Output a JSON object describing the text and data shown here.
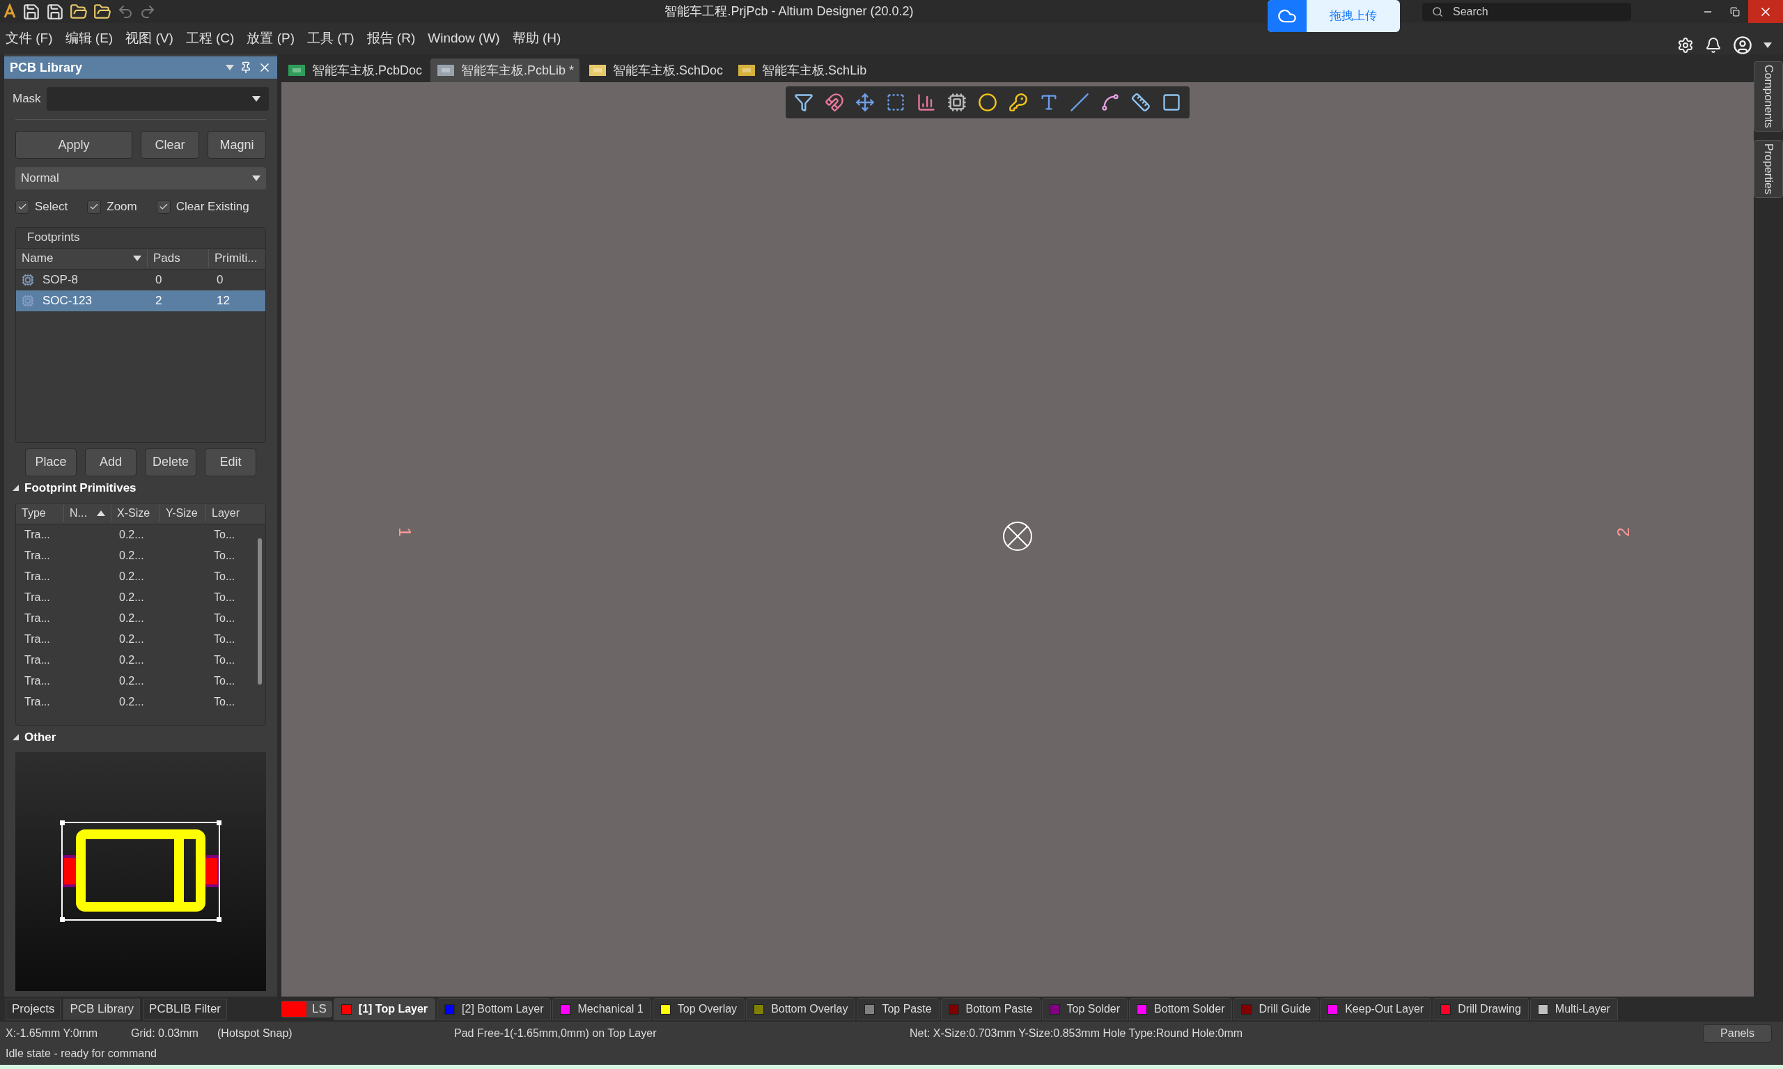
{
  "title_bar": {
    "title": "智能车工程.PrjPcb - Altium Designer (20.0.2)",
    "upload_button": "拖拽上传",
    "search": {
      "placeholder": "Search"
    }
  },
  "menu": [
    "文件 (F)",
    "编辑 (E)",
    "视图 (V)",
    "工程 (C)",
    "放置 (P)",
    "工具 (T)",
    "报告 (R)",
    "Window (W)",
    "帮助 (H)"
  ],
  "panel": {
    "title": "PCB Library",
    "mask": {
      "label": "Mask"
    },
    "filter_buttons": [
      "Apply",
      "Clear",
      "Magni"
    ],
    "mode": "Normal",
    "options": [
      {
        "label": "Select",
        "checked": true
      },
      {
        "label": "Zoom",
        "checked": true
      },
      {
        "label": "Clear Existing",
        "checked": true
      }
    ],
    "footprints": {
      "title": "Footprints",
      "columns": [
        "Name",
        "Pads",
        "Primiti..."
      ],
      "rows": [
        {
          "name": "SOP-8",
          "pads": "0",
          "primitives": "0",
          "selected": false
        },
        {
          "name": "SOC-123",
          "pads": "2",
          "primitives": "12",
          "selected": true
        }
      ]
    },
    "actions": [
      "Place",
      "Add",
      "Delete",
      "Edit"
    ],
    "primitives": {
      "title": "Footprint Primitives",
      "expanded": true,
      "columns": [
        "Type",
        "N...",
        "X-Size",
        "Y-Size",
        "Layer"
      ],
      "rows": [
        {
          "type": "Tra...",
          "x_size": "0.2...",
          "layer": "To..."
        },
        {
          "type": "Tra...",
          "x_size": "0.2...",
          "layer": "To..."
        },
        {
          "type": "Tra...",
          "x_size": "0.2...",
          "layer": "To..."
        },
        {
          "type": "Tra...",
          "x_size": "0.2...",
          "layer": "To..."
        },
        {
          "type": "Tra...",
          "x_size": "0.2...",
          "layer": "To..."
        },
        {
          "type": "Tra...",
          "x_size": "0.2...",
          "layer": "To..."
        },
        {
          "type": "Tra...",
          "x_size": "0.2...",
          "layer": "To..."
        },
        {
          "type": "Tra...",
          "x_size": "0.2...",
          "layer": "To..."
        },
        {
          "type": "Tra...",
          "x_size": "0.2...",
          "layer": "To..."
        }
      ]
    },
    "other": {
      "title": "Other",
      "expanded": true
    }
  },
  "doc_tabs": [
    {
      "label": "智能车主板.PcbDoc",
      "kind": "pcb",
      "selected": false
    },
    {
      "label": "智能车主板.PcbLib *",
      "kind": "pcblib",
      "selected": true
    },
    {
      "label": "智能车主板.SchDoc",
      "kind": "sch",
      "selected": false
    },
    {
      "label": "智能车主板.SchLib",
      "kind": "schlib",
      "selected": false
    }
  ],
  "canvas": {
    "pad_labels": [
      "1",
      "2"
    ]
  },
  "side_panels": [
    "Components",
    "Properties"
  ],
  "bottom_tabs": [
    {
      "label": "Projects",
      "selected": false
    },
    {
      "label": "PCB Library",
      "selected": true
    },
    {
      "label": "PCBLIB Filter",
      "selected": false
    }
  ],
  "layer_set": {
    "label": "LS",
    "color": "#ff0000"
  },
  "layers": [
    {
      "label": "[1] Top Layer",
      "color": "#ff0000",
      "selected": true
    },
    {
      "label": "[2] Bottom Layer",
      "color": "#0000ff",
      "selected": false
    },
    {
      "label": "Mechanical 1",
      "color": "#ff00ff",
      "selected": false
    },
    {
      "label": "Top Overlay",
      "color": "#ffff00",
      "selected": false
    },
    {
      "label": "Bottom Overlay",
      "color": "#808000",
      "selected": false
    },
    {
      "label": "Top Paste",
      "color": "#808080",
      "selected": false
    },
    {
      "label": "Bottom Paste",
      "color": "#800000",
      "selected": false
    },
    {
      "label": "Top Solder",
      "color": "#800080",
      "selected": false
    },
    {
      "label": "Bottom Solder",
      "color": "#ff00ff",
      "selected": false
    },
    {
      "label": "Drill Guide",
      "color": "#800000",
      "selected": false
    },
    {
      "label": "Keep-Out Layer",
      "color": "#ff00ff",
      "selected": false
    },
    {
      "label": "Drill Drawing",
      "color": "#ff002a",
      "selected": false
    },
    {
      "label": "Multi-Layer",
      "color": "#c0c0c0",
      "selected": false
    }
  ],
  "status": {
    "coords": "X:-1.65mm Y:0mm",
    "grid": "Grid: 0.03mm",
    "snap": "(Hotspot Snap)",
    "pad_info": "Pad Free-1(-1.65mm,0mm) on Top Layer",
    "net_info": "Net: X-Size:0.703mm Y-Size:0.853mm Hole Type:Round Hole:0mm",
    "state": "Idle state - ready for command",
    "panels_button": "Panels"
  }
}
